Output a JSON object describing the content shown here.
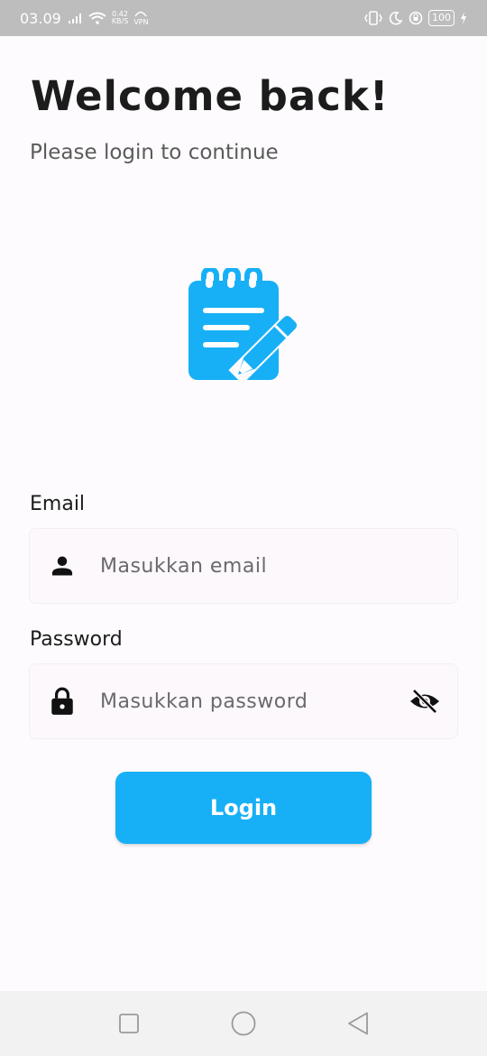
{
  "status_bar": {
    "time": "03.09",
    "network_speed": "0.42",
    "network_unit": "KB/S",
    "vpn_label": "VPN",
    "battery": "100"
  },
  "header": {
    "title": "Welcome back!",
    "subtitle": "Please login to continue"
  },
  "logo": {
    "icon": "notepad-pencil-icon",
    "color": "#17b0f6"
  },
  "form": {
    "email_label": "Email",
    "email_placeholder": "Masukkan email",
    "email_value": "",
    "password_label": "Password",
    "password_placeholder": "Masukkan password",
    "password_value": "",
    "login_label": "Login"
  },
  "colors": {
    "accent": "#17b0f6",
    "background": "#fdfbfd",
    "status_bar": "#bdbdbd"
  },
  "nav_bar": {
    "icons": [
      "recents-square-icon",
      "home-circle-icon",
      "back-triangle-icon"
    ]
  }
}
